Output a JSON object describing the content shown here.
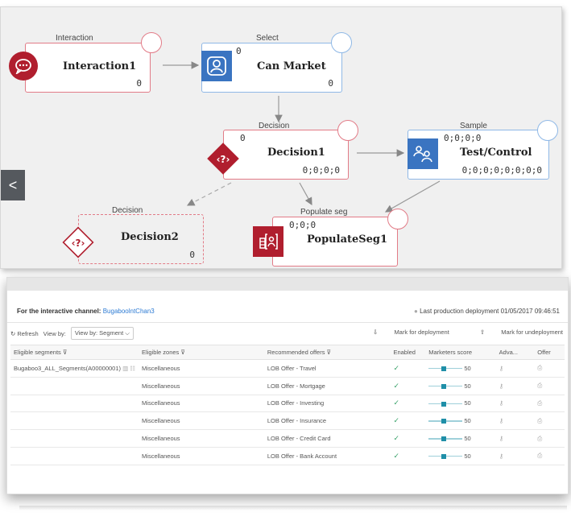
{
  "flow": {
    "nodes": {
      "interaction": {
        "type": "Interaction",
        "name": "Interaction1",
        "count": "0"
      },
      "select": {
        "type": "Select",
        "name": "Can Market",
        "top_count": "0",
        "count": "0"
      },
      "decision1": {
        "type": "Decision",
        "name": "Decision1",
        "top_count": "0",
        "count": "0;0;0;0"
      },
      "sample": {
        "type": "Sample",
        "name": "Test/Control",
        "top_count": "0;0;0;0",
        "count": "0;0;0;0;0;0;0;0"
      },
      "decision2": {
        "type": "Decision",
        "name": "Decision2",
        "count": "0"
      },
      "populate": {
        "type": "Populate seg",
        "name": "PopulateSeg1",
        "top_count": "0;0;0"
      }
    },
    "collapse_glyph": "<",
    "colors": {
      "red": "#b01e2e",
      "blue": "#3a74c1",
      "border_red": "#e27b87",
      "border_blue": "#8fb8e6"
    }
  },
  "table_panel": {
    "channel_label": "For the interactive channel:",
    "channel_name": "BugaboolntChan3",
    "deploy_text": "Last production deployment 01/05/2017 09:46:51",
    "refresh": "Refresh",
    "view_by_label": "View by:",
    "view_by_value": "View by: Segment",
    "mark_deploy": "Mark for deployment",
    "mark_undeploy": "Mark for undeployment",
    "columns": [
      "Eligible segments",
      "Eligible zones",
      "Recommended offers",
      "Enabled",
      "Marketers score",
      "Adva...",
      "Offer"
    ],
    "rows": [
      {
        "segment": "Bugaboo3_ALL_Segments(A00000001)",
        "zone": "Miscellaneous",
        "offer": "LOB Offer - Travel",
        "score": "50"
      },
      {
        "segment": "",
        "zone": "Miscellaneous",
        "offer": "LOB Offer - Mortgage",
        "score": "50"
      },
      {
        "segment": "",
        "zone": "Miscellaneous",
        "offer": "LOB Offer - Investing",
        "score": "50"
      },
      {
        "segment": "",
        "zone": "Miscellaneous",
        "offer": "LOB Offer - Insurance",
        "score": "50"
      },
      {
        "segment": "",
        "zone": "Miscellaneous",
        "offer": "LOB Offer - Credit Card",
        "score": "50"
      },
      {
        "segment": "",
        "zone": "Miscellaneous",
        "offer": "LOB Offer - Bank Account",
        "score": "50"
      }
    ]
  }
}
